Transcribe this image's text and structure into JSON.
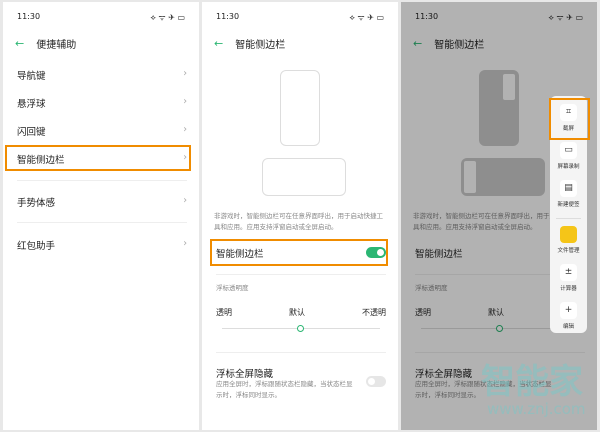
{
  "status": {
    "time": "11:30",
    "icons": "⟡ ᯤ ✈ ▭"
  },
  "panel1": {
    "title": "便捷辅助",
    "items": [
      "导航键",
      "悬浮球",
      "闪回键",
      "智能侧边栏",
      "手势体感",
      "红包助手"
    ]
  },
  "panel2": {
    "title": "智能侧边栏",
    "description": "非游戏时，智能侧边栏可在任意界面呼出，用于启动快捷工具和应用。应用支持浮窗启动或全屏启动。",
    "toggle_label": "智能侧边栏",
    "toggle_on": true,
    "opacity_label": "浮标透明度",
    "opacity_options": [
      "透明",
      "默认",
      "不透明"
    ],
    "opacity_value": 0.5,
    "hide_title": "浮标全屏隐藏",
    "hide_desc": "应用全屏时，浮标跟随状态栏隐藏，当状态栏显示时，浮标同时显示。",
    "hide_on": false
  },
  "sidebar": {
    "items": [
      {
        "label": "截屏",
        "icon": "⌗"
      },
      {
        "label": "屏幕录制",
        "icon": "▭"
      },
      {
        "label": "新建便签",
        "icon": "▤"
      },
      {
        "label": "文件管理",
        "icon": "▬"
      },
      {
        "label": "计算器",
        "icon": "±"
      },
      {
        "label": "编辑",
        "icon": "+"
      }
    ]
  },
  "watermark": {
    "brand": "智能家",
    "url": "www.znj.com"
  },
  "colors": {
    "accent": "#2bb673",
    "highlight": "#f08c00"
  }
}
